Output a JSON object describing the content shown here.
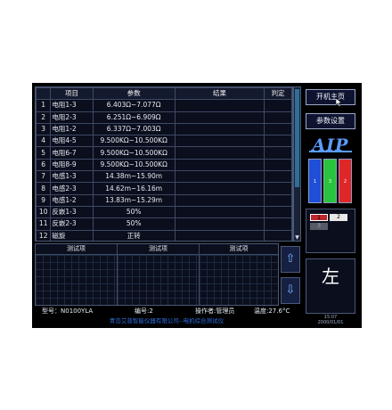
{
  "table": {
    "headers": [
      "",
      "项目",
      "参数",
      "结果",
      "判定"
    ],
    "rows": [
      {
        "no": "1",
        "item": "电阻1-3",
        "param": "6.403Ω~7.077Ω",
        "result": "",
        "verdict": ""
      },
      {
        "no": "2",
        "item": "电阻2-3",
        "param": "6.251Ω~6.909Ω",
        "result": "",
        "verdict": ""
      },
      {
        "no": "3",
        "item": "电阻1-2",
        "param": "6.337Ω~7.003Ω",
        "result": "",
        "verdict": ""
      },
      {
        "no": "4",
        "item": "电阻4-5",
        "param": "9.500KΩ~10.500KΩ",
        "result": "",
        "verdict": ""
      },
      {
        "no": "5",
        "item": "电阻6-7",
        "param": "9.500KΩ~10.500KΩ",
        "result": "",
        "verdict": ""
      },
      {
        "no": "6",
        "item": "电阻8-9",
        "param": "9.500KΩ~10.500KΩ",
        "result": "",
        "verdict": ""
      },
      {
        "no": "7",
        "item": "电感1-3",
        "param": "14.38m~15.90m",
        "result": "",
        "verdict": ""
      },
      {
        "no": "8",
        "item": "电感2-3",
        "param": "14.62m~16.16m",
        "result": "",
        "verdict": ""
      },
      {
        "no": "9",
        "item": "电感1-2",
        "param": "13.83m~15.29m",
        "result": "",
        "verdict": ""
      },
      {
        "no": "10",
        "item": "反嵌1-3",
        "param": "50%",
        "result": "",
        "verdict": ""
      },
      {
        "no": "11",
        "item": "反嵌2-3",
        "param": "50%",
        "result": "",
        "verdict": ""
      },
      {
        "no": "12",
        "item": "磁旋",
        "param": "正转",
        "result": "",
        "verdict": ""
      }
    ]
  },
  "test_items": [
    "测试项",
    "测试项",
    "测试项"
  ],
  "status": {
    "model": "型号：N0100YLA",
    "number": "编号:2",
    "operator": "操作者:管理员",
    "temperature": "温度:27.6°C"
  },
  "footer": "青岛艾普智能仪器有限公司--电机综合测试仪",
  "sidebar": {
    "start_page": "开机主页",
    "param_settings": "参数设置",
    "logo": "AIP",
    "rgb": [
      {
        "label": "1",
        "color": "#1f4fd8"
      },
      {
        "label": "3",
        "color": "#29c43d"
      },
      {
        "label": "2",
        "color": "#e02727"
      }
    ],
    "channels": [
      {
        "label": "1",
        "color": "#c0262c"
      },
      {
        "label": "2",
        "color": "#e8e8e8"
      },
      {
        "label": "3",
        "color": "#555a66"
      }
    ],
    "side_label": "左",
    "time": "15:07",
    "date": "2000/01/01"
  },
  "colors": {
    "accent_blue": "#2f6fe0",
    "panel_bg": "#0b0e1c",
    "border": "#4b5a78"
  }
}
